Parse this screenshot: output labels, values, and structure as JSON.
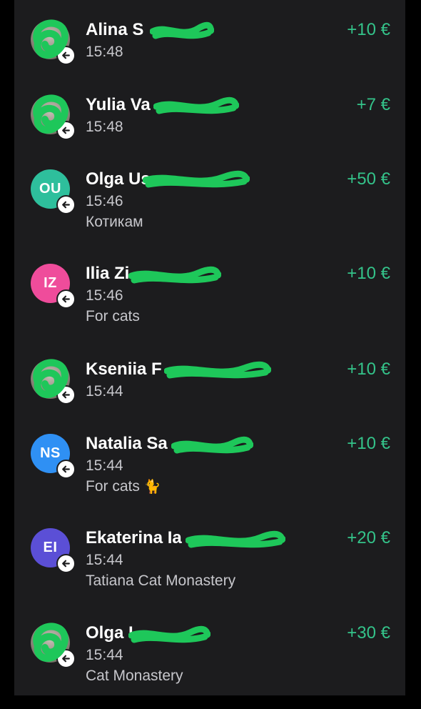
{
  "transactions": [
    {
      "avatar_type": "photo",
      "initials": "",
      "name": "Alina S",
      "time": "15:48",
      "note": "",
      "amount": "+10 €",
      "direction_icon": "arrow-left-icon"
    },
    {
      "avatar_type": "photo",
      "initials": "",
      "name": "Yulia Va",
      "time": "15:48",
      "note": "",
      "amount": "+7 €",
      "direction_icon": "arrow-left-icon"
    },
    {
      "avatar_type": "initials",
      "initials": "OU",
      "avatar_color": "#2ebf9c",
      "name": "Olga Us",
      "time": "15:46",
      "note": "Котикам",
      "amount": "+50 €",
      "direction_icon": "arrow-left-icon"
    },
    {
      "avatar_type": "initials",
      "initials": "IZ",
      "avatar_color": "#ef4c9b",
      "name": "Ilia Zi",
      "time": "15:46",
      "note": "For cats",
      "amount": "+10 €",
      "direction_icon": "arrow-left-icon"
    },
    {
      "avatar_type": "photo",
      "initials": "",
      "name": "Kseniia F",
      "time": "15:44",
      "note": "",
      "amount": "+10 €",
      "direction_icon": "arrow-left-icon"
    },
    {
      "avatar_type": "initials",
      "initials": "NS",
      "avatar_color": "#2f90f4",
      "name": "Natalia Sa",
      "time": "15:44",
      "note": "For cats",
      "note_emoji": "🐈",
      "amount": "+10 €",
      "direction_icon": "arrow-left-icon"
    },
    {
      "avatar_type": "initials",
      "initials": "EI",
      "avatar_color": "#5b4fd6",
      "name": "Ekaterina Ia",
      "time": "15:44",
      "note": "Tatiana Cat Monastery",
      "amount": "+20 €",
      "direction_icon": "arrow-left-icon"
    },
    {
      "avatar_type": "photo",
      "initials": "",
      "name": "Olga L",
      "time": "15:44",
      "note": "Cat Monastery",
      "amount": "+30 €",
      "direction_icon": "arrow-left-icon"
    }
  ],
  "colors": {
    "background": "#000000",
    "panel": "#1c1c1e",
    "amount": "#34c38a",
    "redaction": "#1ec75a"
  }
}
